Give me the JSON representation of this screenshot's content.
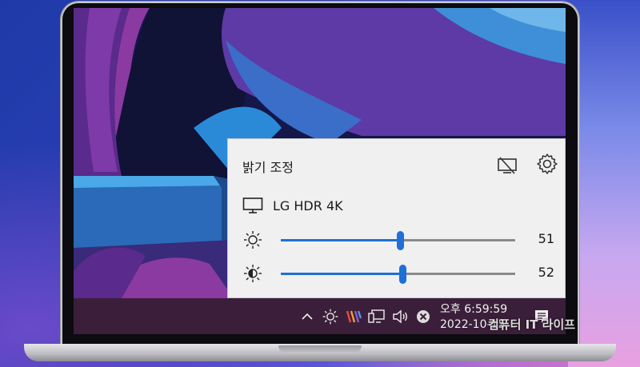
{
  "flyout": {
    "title": "밝기 조정",
    "monitor_name": "LG HDR 4K",
    "brightness": {
      "value_label": "51",
      "value": 51
    },
    "contrast": {
      "value_label": "52",
      "value": 52
    }
  },
  "taskbar": {
    "time": "오후 6:59:59",
    "date": "2022-10-15"
  },
  "watermark": "컴퓨터 IT 라이프",
  "colors": {
    "accent": "#1f6fd6",
    "flyout_bg": "#f0f0f0",
    "taskbar_bg": "#3b1f3a"
  },
  "icons": [
    "monitor-off-icon",
    "gear-icon",
    "monitor-icon",
    "sun-icon",
    "contrast-icon",
    "chevron-up-icon",
    "brightness-tray-icon",
    "app-tray-icon",
    "network-icon",
    "volume-icon",
    "close-circle-icon",
    "notification-icon"
  ]
}
